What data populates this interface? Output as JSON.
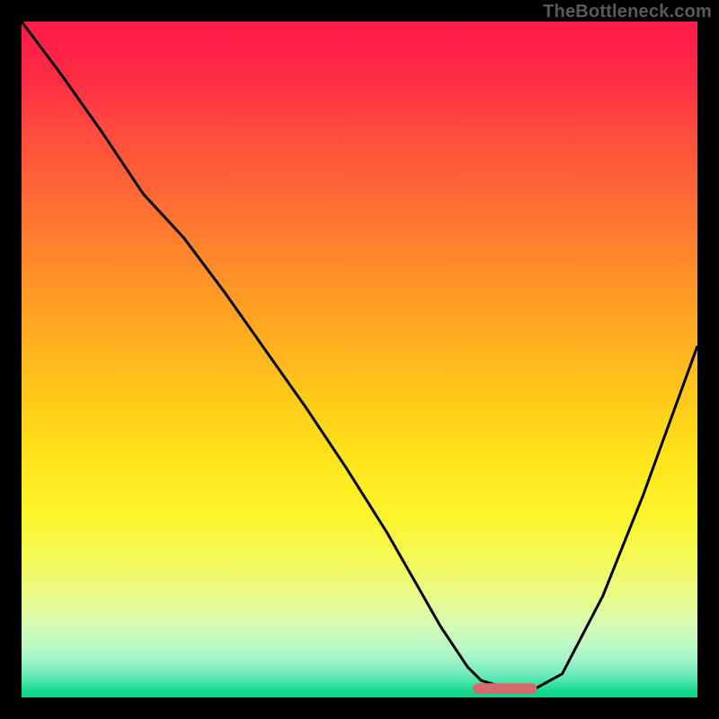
{
  "watermark": "TheBottleneck.com",
  "chart_data": {
    "type": "line",
    "title": "",
    "xlabel": "",
    "ylabel": "",
    "xlim": [
      0,
      100
    ],
    "ylim": [
      0,
      100
    ],
    "grid": false,
    "series": [
      {
        "name": "bottleneck-curve",
        "x": [
          0,
          6,
          12,
          18,
          24,
          30,
          36,
          42,
          48,
          54,
          58,
          62,
          66,
          68,
          72,
          76,
          80,
          86,
          92,
          100
        ],
        "y": [
          100,
          92,
          83.5,
          74.5,
          68,
          60,
          51.5,
          43,
          34,
          24.5,
          17.5,
          10.5,
          4.5,
          2.5,
          1.3,
          1.3,
          3.5,
          15,
          30,
          52
        ]
      }
    ],
    "marker": {
      "name": "optimal-range",
      "x_center": 71.5,
      "y": 1.3,
      "width": 9.5,
      "height": 1.6,
      "color": "#d36a6d"
    },
    "background": {
      "type": "vertical-gradient",
      "stops": [
        {
          "pos": 0,
          "color": "#ff1a4a"
        },
        {
          "pos": 0.5,
          "color": "#ffc81a"
        },
        {
          "pos": 0.82,
          "color": "#f4fa5b"
        },
        {
          "pos": 1.0,
          "color": "#0bd684"
        }
      ]
    }
  }
}
